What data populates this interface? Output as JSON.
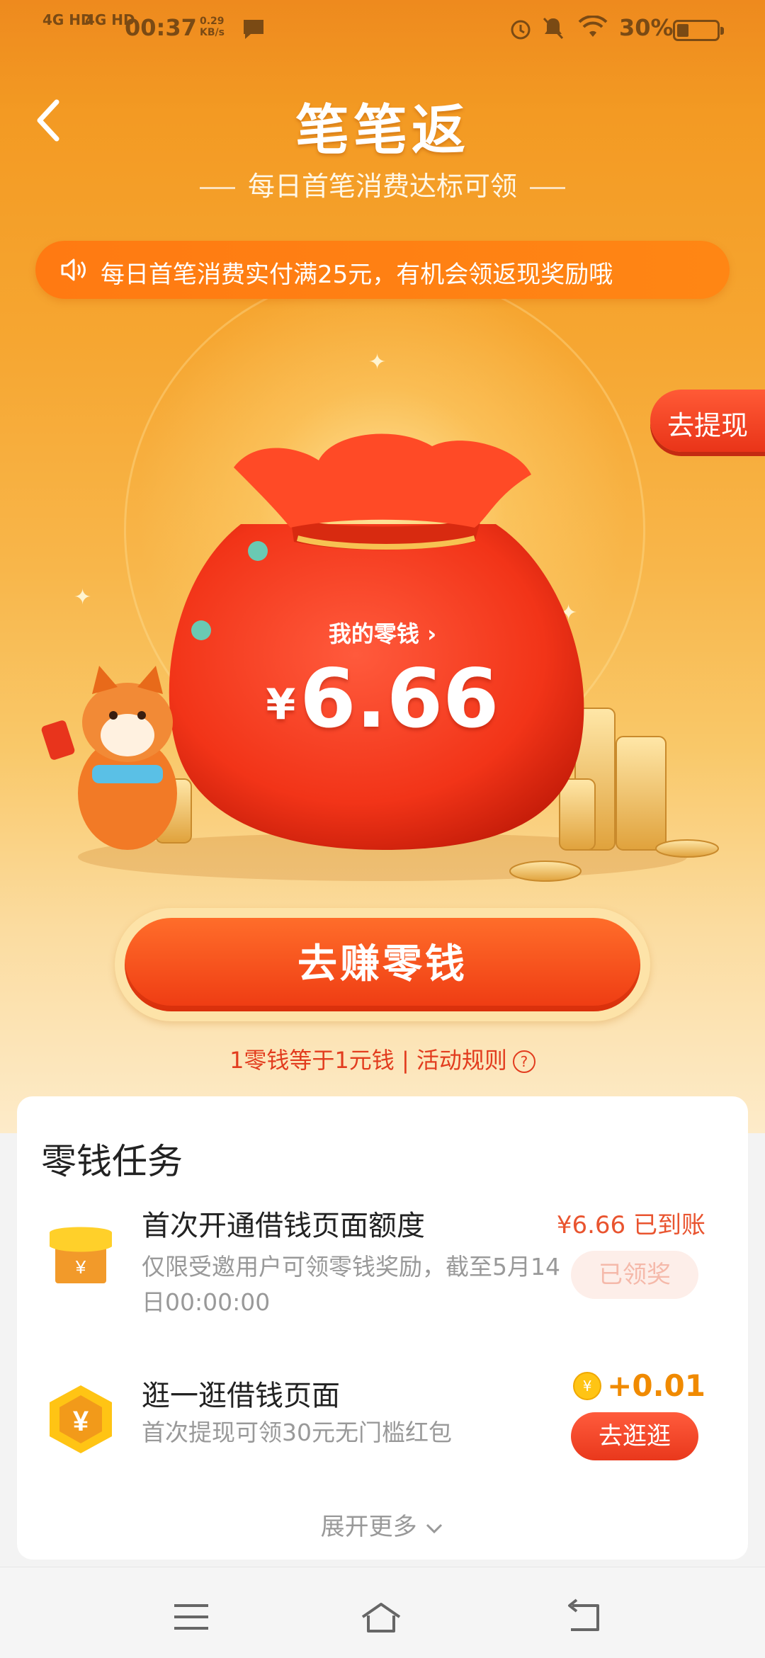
{
  "status_bar": {
    "carrier1": "4G HD",
    "carrier2": "4G HD",
    "time": "00:37",
    "net_speed": "0.29 KB/s",
    "battery": "30%",
    "battery_level": 0.3
  },
  "header": {
    "title": "笔笔返",
    "subtitle": "每日首笔消费达标可领"
  },
  "notice": {
    "text": "每日首笔消费实付满25元，有机会领返现奖励哦"
  },
  "withdraw_button": "去提现",
  "wallet": {
    "label": "我的零钱",
    "currency": "¥",
    "amount": "6.66"
  },
  "earn_button": "去赚零钱",
  "rules": {
    "text": "1零钱等于1元钱 | 活动规则",
    "help_symbol": "?"
  },
  "tasks_card": {
    "title": "零钱任务",
    "tasks": [
      {
        "title": "首次开通借钱页面额度",
        "desc": "仅限受邀用户可领零钱奖励，截至5月14日00:00:00",
        "reward": "¥6.66 已到账",
        "button": "已领奖",
        "icon": "shop-icon"
      },
      {
        "title": "逛一逛借钱页面",
        "desc": "首次提现可领30元无门槛红包",
        "reward_coin_symbol": "¥",
        "reward": "+0.01",
        "button": "去逛逛",
        "icon": "yuan-hexagon-icon"
      }
    ],
    "expand_more": "展开更多"
  },
  "colors": {
    "accent": "#ff7a12",
    "button_red": "#ee3a12",
    "reward_red": "#e9542f",
    "coin_gold": "#ffc414"
  }
}
